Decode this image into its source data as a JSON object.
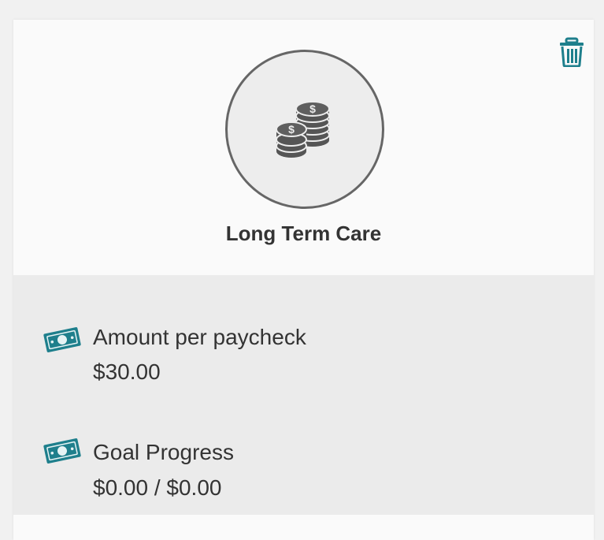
{
  "goal": {
    "title": "Long Term Care",
    "icon": "coins-icon"
  },
  "actions": {
    "delete_icon": "trash-icon"
  },
  "details": [
    {
      "icon": "cash-icon",
      "label": "Amount per paycheck",
      "value": "$30.00"
    },
    {
      "icon": "cash-icon",
      "label": "Goal Progress",
      "value": "$0.00 / $0.00"
    }
  ],
  "colors": {
    "accent": "#1e7f8c",
    "circle_border": "#666666",
    "text": "#333333",
    "details_bg": "#ebebeb"
  }
}
